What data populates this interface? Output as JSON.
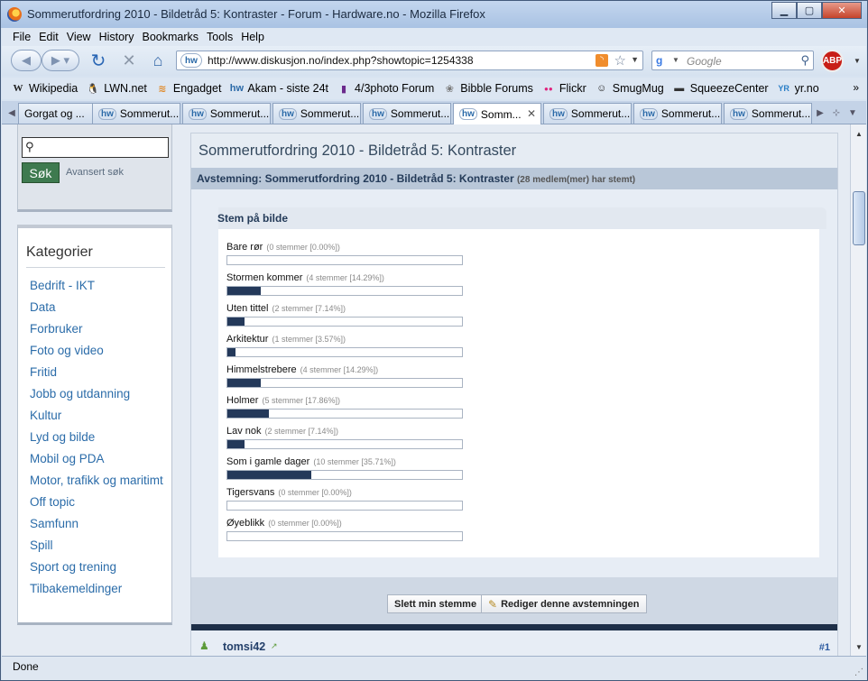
{
  "window": {
    "title": "Sommerutfordring 2010 - Bildetråd 5: Kontraster - Forum - Hardware.no - Mozilla Firefox"
  },
  "menu": [
    "File",
    "Edit",
    "View",
    "History",
    "Bookmarks",
    "Tools",
    "Help"
  ],
  "navbar": {
    "url": "http://www.diskusjon.no/index.php?showtopic=1254338",
    "site_icon": "hw",
    "search_placeholder": "Google",
    "abp_label": "ABP"
  },
  "bookmarks": [
    {
      "label": "Wikipedia",
      "icon": "W"
    },
    {
      "label": "LWN.net",
      "icon": "🐧"
    },
    {
      "label": "Engadget",
      "icon": "≋"
    },
    {
      "label": "Akam - siste 24t",
      "icon": "hw"
    },
    {
      "label": "4/3photo Forum",
      "icon": "▮"
    },
    {
      "label": "Bibble Forums",
      "icon": "❀"
    },
    {
      "label": "Flickr",
      "icon": "●●"
    },
    {
      "label": "SmugMug",
      "icon": "☺"
    },
    {
      "label": "SqueezeCenter",
      "icon": "▬"
    },
    {
      "label": "yr.no",
      "icon": "YR"
    }
  ],
  "bookmarks_more": "»",
  "tabs": [
    {
      "label": "Gorgat og ...",
      "icon": ""
    },
    {
      "label": "Sommerut...",
      "icon": "hw"
    },
    {
      "label": "Sommerut...",
      "icon": "hw"
    },
    {
      "label": "Sommerut...",
      "icon": "hw"
    },
    {
      "label": "Sommerut...",
      "icon": "hw"
    },
    {
      "label": "Somm...",
      "icon": "hw",
      "active": true
    },
    {
      "label": "Sommerut...",
      "icon": "hw"
    },
    {
      "label": "Sommerut...",
      "icon": "hw"
    },
    {
      "label": "Sommerut...",
      "icon": "hw"
    }
  ],
  "sidebar": {
    "search_button": "Søk",
    "advanced_link": "Avansert søk",
    "categories_title": "Kategorier",
    "categories": [
      "Bedrift - IKT",
      "Data",
      "Forbruker",
      "Foto og video",
      "Fritid",
      "Jobb og utdanning",
      "Kultur",
      "Lyd og bilde",
      "Mobil og PDA",
      "Motor, trafikk og maritimt",
      "Off topic",
      "Samfunn",
      "Spill",
      "Sport og trening",
      "Tilbakemeldinger"
    ]
  },
  "topic": {
    "title": "Sommerutfordring 2010 - Bildetråd 5: Kontraster",
    "poll_heading": "Avstemning: Sommerutfordring 2010 - Bildetråd 5: Kontraster",
    "poll_votes": "(28 medlem(mer) har stemt)",
    "question": "Stem på bilde",
    "options": [
      {
        "label": "Bare rør",
        "count": "(0 stemmer [0.00%])",
        "percent": 0.0
      },
      {
        "label": "Stormen kommer",
        "count": "(4 stemmer [14.29%])",
        "percent": 14.29
      },
      {
        "label": "Uten tittel",
        "count": "(2 stemmer [7.14%])",
        "percent": 7.14
      },
      {
        "label": "Arkitektur",
        "count": "(1 stemmer [3.57%])",
        "percent": 3.57
      },
      {
        "label": "Himmelstrebere",
        "count": "(4 stemmer [14.29%])",
        "percent": 14.29
      },
      {
        "label": "Holmer",
        "count": "(5 stemmer [17.86%])",
        "percent": 17.86
      },
      {
        "label": "Lav nok",
        "count": "(2 stemmer [7.14%])",
        "percent": 7.14
      },
      {
        "label": "Som i gamle dager",
        "count": "(10 stemmer [35.71%])",
        "percent": 35.71
      },
      {
        "label": "Tigersvans",
        "count": "(0 stemmer [0.00%])",
        "percent": 0.0
      },
      {
        "label": "Øyeblikk",
        "count": "(0 stemmer [0.00%])",
        "percent": 0.0
      }
    ],
    "delete_vote_button": "Slett min stemme",
    "edit_poll_button": "Rediger denne avstemningen",
    "first_post_user": "tomsi42",
    "first_post_number": "#1"
  },
  "status": "Done",
  "colors": {
    "bar_fill": "#24395a",
    "link": "#2b6ca9",
    "search_button_bg": "#3e7a4f"
  }
}
